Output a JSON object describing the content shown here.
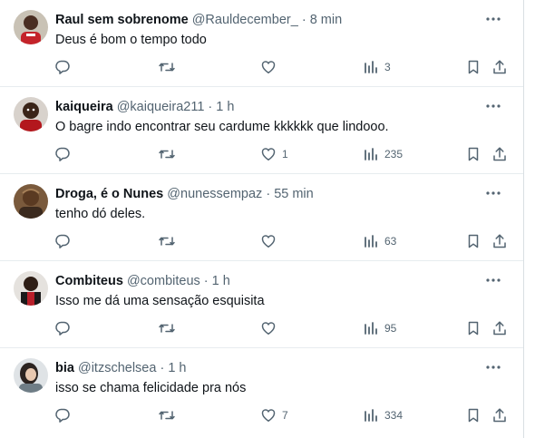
{
  "replies": [
    {
      "name": "Raul sem sobrenome",
      "handle": "@Rauldecember_",
      "time": "8 min",
      "text": "Deus é bom o tempo todo",
      "likes": "",
      "views": "3"
    },
    {
      "name": "kaiqueira",
      "handle": "@kaiqueira211",
      "time": "1 h",
      "text": "O bagre indo encontrar seu cardume kkkkkk que lindooo.",
      "likes": "1",
      "views": "235"
    },
    {
      "name": "Droga, é o Nunes",
      "handle": "@nunessempaz",
      "time": "55 min",
      "text": "tenho dó deles.",
      "likes": "",
      "views": "63"
    },
    {
      "name": "Combiteus",
      "handle": "@combiteus",
      "time": "1 h",
      "text": "Isso me dá uma sensação esquisita",
      "likes": "",
      "views": "95"
    },
    {
      "name": "bia",
      "handle": "@itzschelsea",
      "time": "1 h",
      "text": "isso se chama felicidade pra nós",
      "likes": "7",
      "views": "334"
    }
  ],
  "separator": "·",
  "colors": {
    "text": "#0f1419",
    "muted": "#536471",
    "border": "#e7ecef"
  },
  "icons": [
    "more-icon",
    "reply-icon",
    "retweet-icon",
    "like-icon",
    "views-icon",
    "bookmark-icon",
    "share-icon"
  ]
}
